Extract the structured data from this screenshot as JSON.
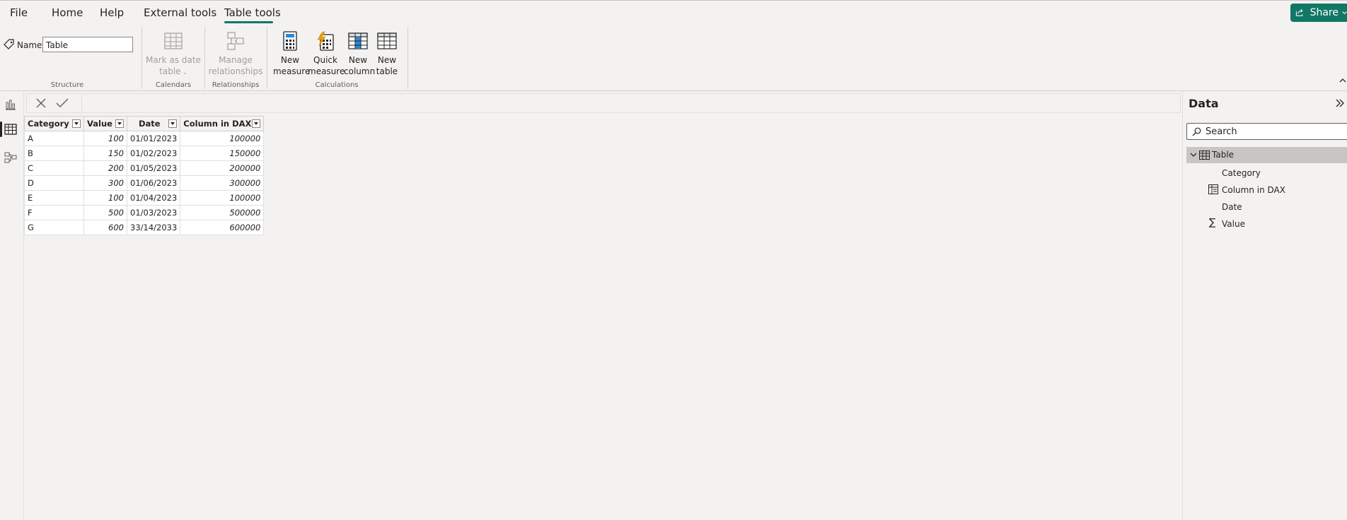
{
  "menu": {
    "items": [
      "File",
      "Home",
      "Help",
      "External tools",
      "Table tools"
    ],
    "share_label": "Share"
  },
  "ribbon": {
    "name_label": "Name",
    "name_value": "Table",
    "structure_label": "Structure",
    "mark_date_line1": "Mark as date",
    "mark_date_line2": "table",
    "calendars_label": "Calendars",
    "manage_line1": "Manage",
    "manage_line2": "relationships",
    "relationships_label": "Relationships",
    "new_measure_line1": "New",
    "new_measure_line2": "measure",
    "quick_measure_line1": "Quick",
    "quick_measure_line2": "measure",
    "new_column_line1": "New",
    "new_column_line2": "column",
    "new_table_line1": "New",
    "new_table_line2": "table",
    "calculations_label": "Calculations"
  },
  "grid": {
    "columns": [
      "Category",
      "Value",
      "Date",
      "Column in DAX"
    ],
    "rows": [
      [
        "A",
        "100",
        "01/01/2023",
        "100000"
      ],
      [
        "B",
        "150",
        "01/02/2023",
        "150000"
      ],
      [
        "C",
        "200",
        "01/05/2023",
        "200000"
      ],
      [
        "D",
        "300",
        "01/06/2023",
        "300000"
      ],
      [
        "E",
        "100",
        "01/04/2023",
        "100000"
      ],
      [
        "F",
        "500",
        "01/03/2023",
        "500000"
      ],
      [
        "G",
        "600",
        "33/14/2033",
        "600000"
      ]
    ]
  },
  "data_pane": {
    "title": "Data",
    "search_placeholder": "Search",
    "table_name": "Table",
    "fields": [
      "Category",
      "Column in DAX",
      "Date",
      "Value"
    ]
  },
  "colors": {
    "accent": "#117865",
    "background": "#f3f2f1"
  }
}
